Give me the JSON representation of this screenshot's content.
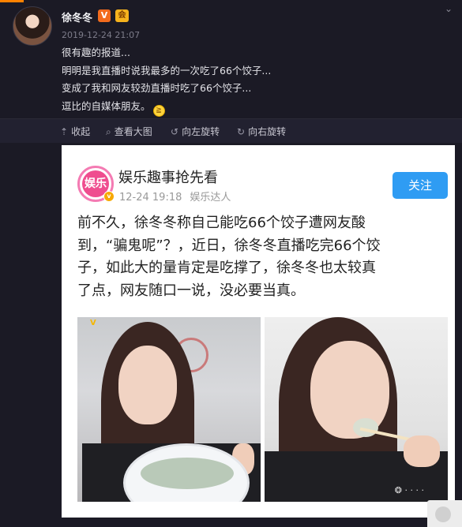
{
  "post": {
    "username": "徐冬冬",
    "verified_badge": "V",
    "vip_badge": "会",
    "timestamp": "2019-12-24 21:07",
    "lines": [
      "很有趣的报道...",
      "明明是我直播时说我最多的一次吃了66个饺子...",
      "变成了我和网友较劲直播时吃了66个饺子...",
      "逗比的自媒体朋友。"
    ],
    "emoji": "laugh-cry-emoji"
  },
  "toolbar": {
    "collapse": "收起",
    "view_large": "查看大图",
    "rotate_left": "向左旋转",
    "rotate_right": "向右旋转"
  },
  "embedded": {
    "logo_text": "娱乐",
    "account_name": "娱乐趣事抢先看",
    "date": "12-24 19:18",
    "account_type": "娱乐达人",
    "follow_label": "关注",
    "body_lines": [
      "前不久，徐冬冬称自己能吃66个饺子遭网友酸",
      "到，“骗鬼呢”？，近日，徐冬冬直播吃完66个饺",
      "子，如此大的量肯定是吃撑了，徐冬冬也太较真",
      "了点，网友随口一说，没必要当真。"
    ]
  },
  "colors": {
    "page_bg": "#1b1a25",
    "accent_orange": "#ff8200",
    "follow_button": "#2f9cf3",
    "logo_pink": "#ef4d8f"
  }
}
